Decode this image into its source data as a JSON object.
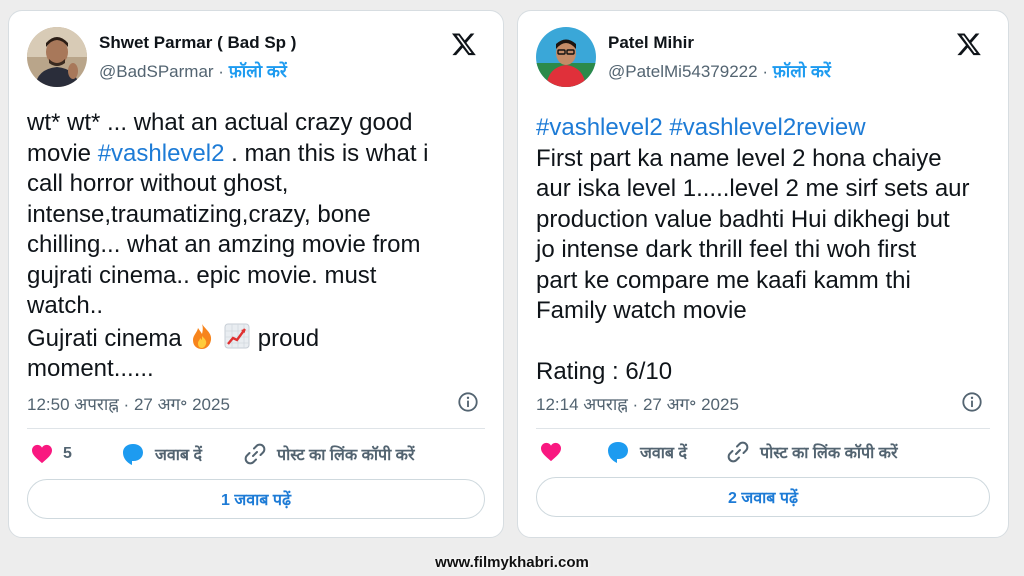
{
  "tweets": [
    {
      "author_name": "Shwet Parmar ( Bad Sp )",
      "handle": "@BadSParmar",
      "separator": " · ",
      "follow_label": "फ़ॉलो करें",
      "avatar_icon": "avatar-photo",
      "platform_icon": "x-logo-icon",
      "lines": [
        [
          "wt* wt* ... what an actual crazy good"
        ],
        [
          "movie  ",
          "#vashlevel2",
          " . man this is what i"
        ],
        [
          "call horror without ghost,"
        ],
        [
          "intense,traumatizing,crazy, bone"
        ],
        [
          "chilling... what an amzing movie from"
        ],
        [
          "gujrati cinema.. epic movie. must"
        ],
        [
          "watch.."
        ],
        [
          "Gujrati cinema "
        ],
        [
          "moment......"
        ]
      ],
      "emoji_line_suffix": " proud",
      "emojis": [
        "fire-icon",
        "chart-increasing-icon"
      ],
      "timestamp": "12:50 अपराह्न · 27 अग॰ 2025",
      "likes_count": "5",
      "reply_label": "जवाब दें",
      "copy_link_label": "पोस्ट का लिंक कॉपी करें",
      "read_replies_label": "1 जवाब पढ़ें",
      "liked": true
    },
    {
      "author_name": "Patel Mihir",
      "handle": "@PatelMi54379222",
      "separator": " · ",
      "follow_label": "फ़ॉलो करें",
      "avatar_icon": "avatar-photo",
      "platform_icon": "x-logo-icon",
      "hashtags_line": [
        "#vashlevel2",
        " ",
        "#vashlevel2review"
      ],
      "lines": [
        "First part ka name level 2 hona chaiye",
        "aur iska level 1.....level 2 me sirf sets aur",
        "production value badhti Hui dikhegi but",
        "jo intense dark thrill feel thi woh first",
        "part ke compare me kaafi kamm thi",
        "Family watch movie"
      ],
      "rating": "Rating : 6/10",
      "timestamp": "12:14 अपराह्न · 27 अग॰ 2025",
      "reply_label": "जवाब दें",
      "copy_link_label": "पोस्ट का लिंक कॉपी करें",
      "read_replies_label": "2 जवाब पढ़ें",
      "liked": true
    }
  ],
  "colors": {
    "link": "#1d9bf0",
    "hashtag": "#1d7bd6",
    "like": "#f91880",
    "muted": "#536471"
  },
  "watermark": "www.filmykhabri.com"
}
